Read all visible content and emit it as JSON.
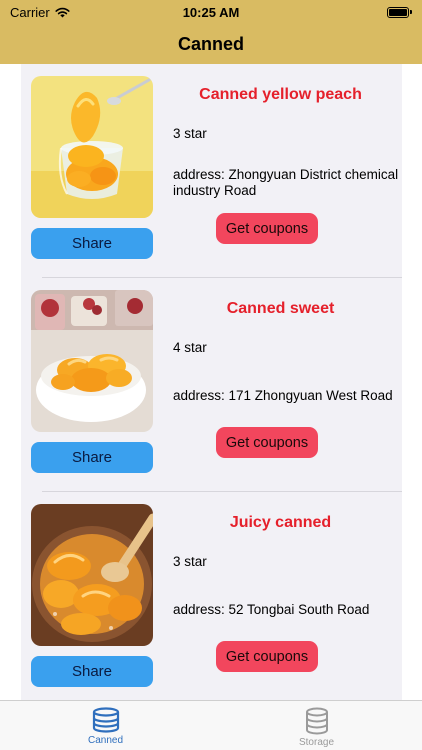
{
  "status_bar": {
    "carrier": "Carrier",
    "time": "10:25 AM"
  },
  "nav": {
    "title": "Canned"
  },
  "items": [
    {
      "name": "Canned yellow peach",
      "rating": "3 star",
      "address": "address: Zhongyuan District chemical industry Road",
      "share_label": "Share",
      "coupon_label": "Get coupons"
    },
    {
      "name": "Canned sweet",
      "rating": "4 star",
      "address": "address:  171 Zhongyuan West Road",
      "share_label": "Share",
      "coupon_label": "Get coupons"
    },
    {
      "name": "Juicy canned",
      "rating": "3 star",
      "address": "address: 52 Tongbai South Road",
      "share_label": "Share",
      "coupon_label": "Get coupons"
    }
  ],
  "tabs": [
    {
      "label": "Canned",
      "icon": "database-icon",
      "active": true
    },
    {
      "label": "Storage",
      "icon": "database-icon",
      "active": false
    }
  ],
  "colors": {
    "bar_background": "#d9bb62",
    "title_red": "#e5202b",
    "share_button": "#3aa0ee",
    "coupon_button": "#f2465d",
    "tab_active": "#2f6fbd",
    "tab_inactive": "#9a9a9a"
  }
}
